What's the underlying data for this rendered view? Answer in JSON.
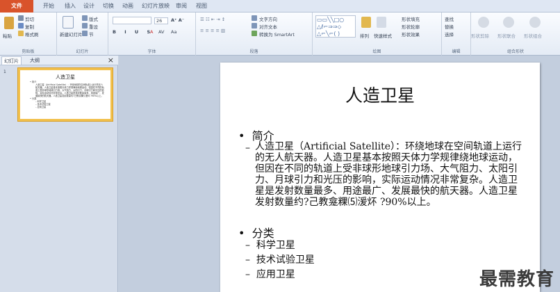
{
  "tabs": [
    "文件",
    "开始",
    "插入",
    "设计",
    "切换",
    "动画",
    "幻灯片放映",
    "审阅",
    "视图"
  ],
  "ribbon": {
    "clipboard": {
      "paste": "粘贴",
      "cut": "剪切",
      "copy": "复制",
      "format_painter": "格式刷",
      "label": "剪贴板"
    },
    "slides": {
      "new_slide": "新建幻灯片",
      "layout": "版式",
      "reset": "重设",
      "section": "节",
      "label": "幻灯片"
    },
    "font": {
      "size": "26",
      "label": "字体"
    },
    "paragraph": {
      "text_direction": "文字方向",
      "align_text": "对齐文本",
      "smartart": "转换为 SmartArt",
      "label": "段落"
    },
    "drawing": {
      "arrange": "排列",
      "quick_styles": "快速样式",
      "shape_fill": "形状填充",
      "shape_outline": "形状轮廓",
      "shape_effects": "形状效果",
      "label": "绘图"
    },
    "editing": {
      "find": "查找",
      "replace": "替换",
      "select": "选择",
      "label": "编辑"
    },
    "combine": {
      "union": "形状剪除",
      "combine": "形状联合",
      "intersect": "形状组合",
      "label": "组合形状"
    }
  },
  "pane": {
    "tab_slides": "幻灯片",
    "tab_outline": "大纲",
    "close": "×",
    "slide_number": "1"
  },
  "slide": {
    "title": "人造卫星",
    "bullet1": "简介",
    "intro_text": "人造卫星（Artificial Satellite）：环绕地球在空间轨道上运行的无人航天器。人造卫星基本按照天体力学规律绕地球运动，但因在不同的轨道上受非球形地球引力场、大气阻力、太阳引力、月球引力和光压的影响，实际运动情况非常复杂。人造卫星是发射数量最多、用途最广、发展最快的航天器。人造卫星发射数量约?己教龛粿⑸湲炋  ?90%以上。",
    "bullet2": "分类",
    "sub_items": [
      "科学卫星",
      "技术试验卫星",
      "应用卫星"
    ]
  },
  "watermark": "最需教育"
}
